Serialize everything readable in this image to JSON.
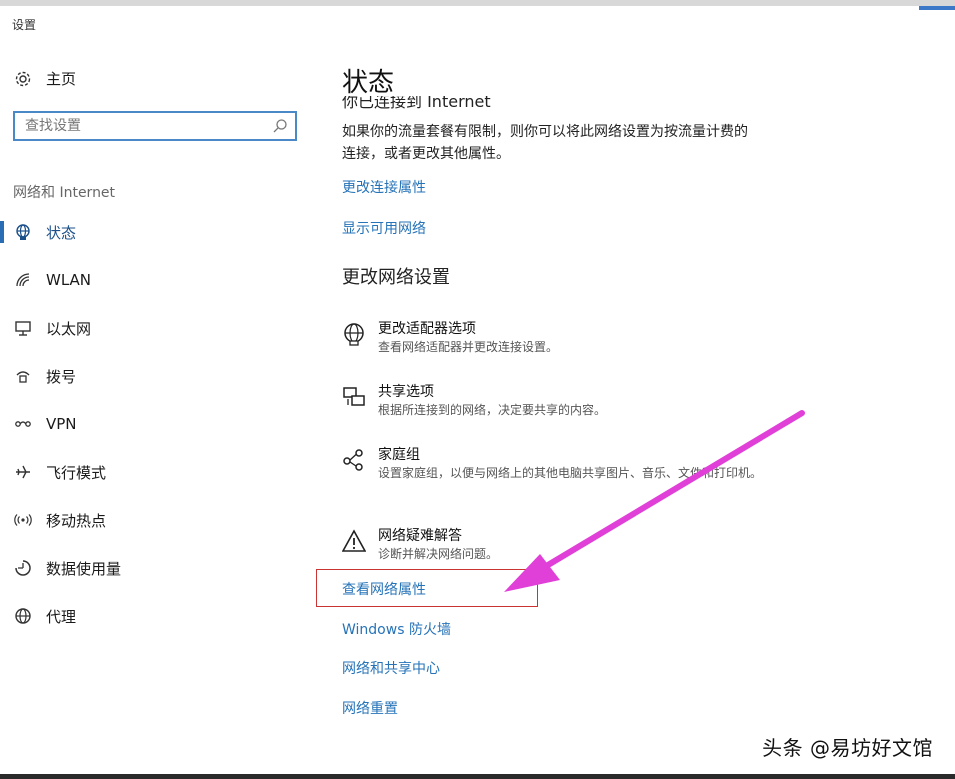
{
  "window": {
    "title": "设置"
  },
  "sidebar": {
    "home_label": "主页",
    "search_placeholder": "查找设置",
    "section_label": "网络和 Internet",
    "items": [
      {
        "label": "状态",
        "icon": "globe-icon",
        "active": true
      },
      {
        "label": "WLAN",
        "icon": "wifi-icon"
      },
      {
        "label": "以太网",
        "icon": "ethernet-icon"
      },
      {
        "label": "拨号",
        "icon": "dialup-icon"
      },
      {
        "label": "VPN",
        "icon": "vpn-icon"
      },
      {
        "label": "飞行模式",
        "icon": "airplane-icon"
      },
      {
        "label": "移动热点",
        "icon": "hotspot-icon"
      },
      {
        "label": "数据使用量",
        "icon": "data-usage-icon"
      },
      {
        "label": "代理",
        "icon": "proxy-globe-icon"
      }
    ]
  },
  "main": {
    "title": "状态",
    "cut_off_text": "你已连接到 Internet",
    "description": "如果你的流量套餐有限制，则你可以将此网络设置为按流量计费的连接，或者更改其他属性。",
    "links_top": [
      "更改连接属性",
      "显示可用网络"
    ],
    "section_heading": "更改网络设置",
    "options": [
      {
        "title": "更改适配器选项",
        "subtitle": "查看网络适配器并更改连接设置。",
        "icon": "adapter-icon"
      },
      {
        "title": "共享选项",
        "subtitle": "根据所连接到的网络，决定要共享的内容。",
        "icon": "sharing-icon"
      },
      {
        "title": "家庭组",
        "subtitle": "设置家庭组，以便与网络上的其他电脑共享图片、音乐、文件和打印机。",
        "icon": "homegroup-icon"
      },
      {
        "title": "网络疑难解答",
        "subtitle": "诊断并解决网络问题。",
        "icon": "warning-icon"
      }
    ],
    "links_bottom": [
      "查看网络属性",
      "Windows 防火墙",
      "网络和共享中心",
      "网络重置"
    ]
  },
  "watermark": "头条 @易坊好文馆",
  "colors": {
    "link": "#2673b8",
    "accent": "#2b6db5",
    "arrow": "#e040d8",
    "highlight": "#cc3333"
  }
}
